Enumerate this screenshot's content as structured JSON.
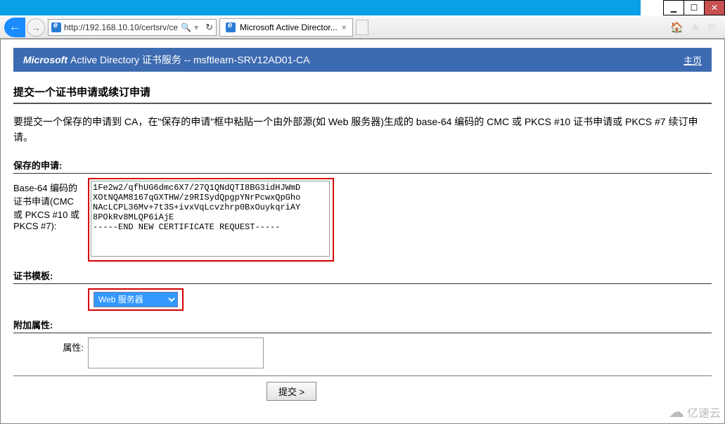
{
  "window": {
    "top_color": "#0aa0e8"
  },
  "toolbar": {
    "url": "http://192.168.10.10/certsrv/ce",
    "search_icon": "🔍",
    "refresh_icon": "↻",
    "tab_title": "Microsoft Active Director...",
    "right_icons": [
      "🏠",
      "★",
      "⚙"
    ]
  },
  "banner": {
    "brand": "Microsoft",
    "service": " Active Directory 证书服务  --  msftlearn-SRV12AD01-CA",
    "home": "主页"
  },
  "content": {
    "heading": "提交一个证书申请或续订申请",
    "intro": "要提交一个保存的申请到 CA，在\"保存的申请\"框中粘贴一个由外部源(如 Web 服务器)生成的 base-64 编码的 CMC 或 PKCS #10 证书申请或 PKCS #7 续订申请。",
    "saved_request_label": "保存的申请:",
    "cert_field_label": "Base-64 编码的证书申请(CMC 或 PKCS #10 或 PKCS #7):",
    "cert_value": "1Fe2w2/qfhUG6dmc6X7/27Q1QNdQTI8BG3idHJWmD\nXOtNQAM8167qGXTHW/z9RISydQpgpYNrPcwxQpGho\nNAcLCPL36Mv+7t3S+ivxVqLcvzhrp0BxOuykqriAY\n8POkRv8MLQP6iAjE\n-----END NEW CERTIFICATE REQUEST-----",
    "template_section": "证书模板:",
    "template_selected": "Web 服务器",
    "attr_section": "附加属性:",
    "attr_label": "属性:",
    "attr_value": "",
    "submit": "提交 >"
  },
  "watermark": "亿速云"
}
